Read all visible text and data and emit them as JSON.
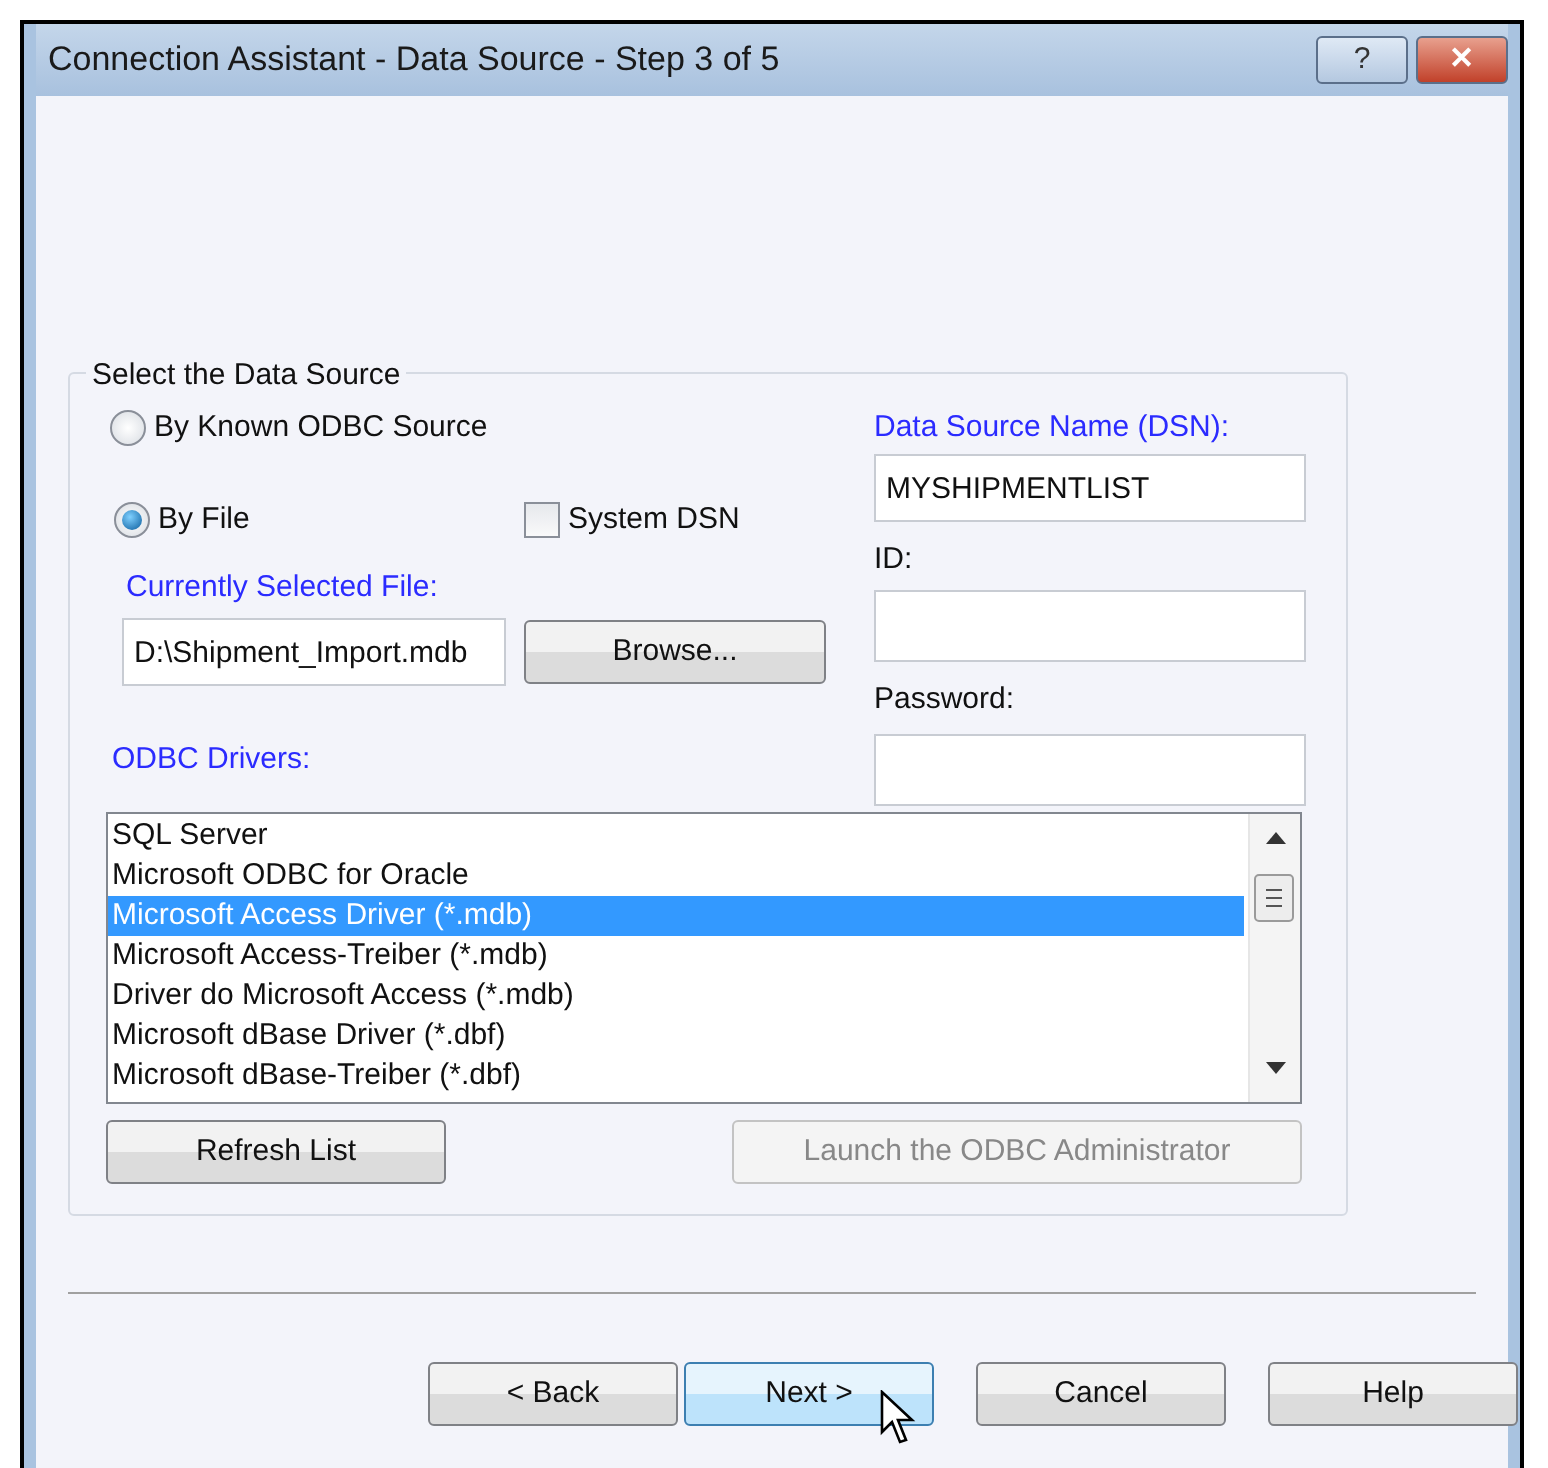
{
  "window": {
    "title": "Connection Assistant - Data Source - Step 3 of 5",
    "title_buttons": [
      "?",
      "✕"
    ]
  },
  "group": {
    "title": "Select the Data Source",
    "source_options": [
      {
        "label": "By Known ODBC Source",
        "selected": false
      },
      {
        "label": "By File",
        "selected": true
      }
    ],
    "system_dsn": {
      "label": "System DSN",
      "checked": false
    },
    "file": {
      "label": "Currently Selected File:",
      "value": "D:\\Shipment_Import.mdb"
    },
    "browse_button": "Browse...",
    "dsn": {
      "label": "Data Source Name (DSN):",
      "value": "MYSHIPMENTLIST"
    },
    "id": {
      "label": "ID:"
    },
    "password": {
      "label": "Password:"
    },
    "drivers_label": "ODBC Drivers:",
    "drivers": [
      {
        "label": "SQL Server",
        "selected": false
      },
      {
        "label": "Microsoft ODBC for Oracle",
        "selected": false
      },
      {
        "label": "Microsoft Access Driver (*.mdb)",
        "selected": true
      },
      {
        "label": "Microsoft Access-Treiber (*.mdb)",
        "selected": false
      },
      {
        "label": "Driver do Microsoft Access (*.mdb)",
        "selected": false
      },
      {
        "label": "Microsoft dBase Driver (*.dbf)",
        "selected": false
      },
      {
        "label": "Microsoft dBase-Treiber (*.dbf)",
        "selected": false
      }
    ],
    "refresh_button": {
      "label": "Refresh List",
      "disabled": false
    },
    "admin_button": {
      "label": "Launch the ODBC Administrator",
      "disabled": true
    }
  },
  "buttons": [
    {
      "label": "< Back",
      "hovered": false
    },
    {
      "label": "Next >",
      "hovered": true
    },
    {
      "label": "Cancel",
      "hovered": false
    },
    {
      "label": "Help",
      "hovered": false
    }
  ]
}
